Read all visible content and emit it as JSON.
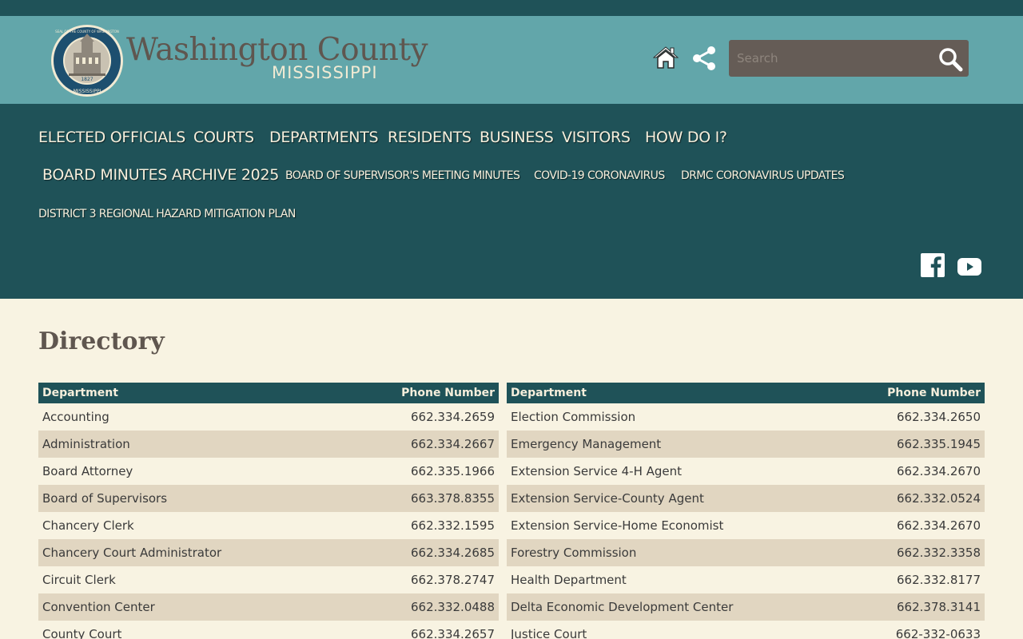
{
  "brand": {
    "title": "Washington County",
    "subtitle": "MISSISSIPPI",
    "seal_ring_text": "SEAL OF THE COUNTY OF WASHINGTON",
    "seal_year": "1827",
    "seal_state": "MISSISSIPPI"
  },
  "search": {
    "placeholder": "Search"
  },
  "nav": {
    "row1": [
      "ELECTED OFFICIALS",
      "COURTS",
      "DEPARTMENTS",
      "RESIDENTS",
      "BUSINESS",
      "VISITORS",
      "HOW DO I?"
    ],
    "row2": [
      "BOARD MINUTES ARCHIVE 2025",
      "BOARD OF SUPERVISOR'S MEETING MINUTES",
      "COVID-19 CORONAVIRUS",
      "DRMC CORONAVIRUS UPDATES"
    ],
    "row3": [
      "DISTRICT 3 REGIONAL HAZARD MITIGATION PLAN"
    ]
  },
  "page": {
    "title": "Directory"
  },
  "directory": {
    "headers": {
      "department": "Department",
      "phone": "Phone Number"
    },
    "left": [
      {
        "dept": "Accounting",
        "phone": "662.334.2659"
      },
      {
        "dept": "Administration",
        "phone": "662.334.2667"
      },
      {
        "dept": "Board Attorney",
        "phone": "662.335.1966"
      },
      {
        "dept": "Board of Supervisors",
        "phone": "663.378.8355"
      },
      {
        "dept": "Chancery Clerk",
        "phone": "662.332.1595"
      },
      {
        "dept": "Chancery Court Administrator",
        "phone": "662.334.2685"
      },
      {
        "dept": "Circuit Clerk",
        "phone": "662.378.2747"
      },
      {
        "dept": "Convention Center",
        "phone": "662.332.0488"
      },
      {
        "dept": "County Court",
        "phone": "662.334.2657"
      }
    ],
    "right": [
      {
        "dept": "Election Commission",
        "phone": "662.334.2650"
      },
      {
        "dept": "Emergency Management",
        "phone": "662.335.1945"
      },
      {
        "dept": "Extension Service 4-H Agent",
        "phone": "662.334.2670"
      },
      {
        "dept": "Extension Service-County Agent",
        "phone": "662.332.0524"
      },
      {
        "dept": "Extension Service-Home Economist",
        "phone": "662.334.2670"
      },
      {
        "dept": "Forestry Commission",
        "phone": "662.332.3358"
      },
      {
        "dept": "Health Department",
        "phone": "662.332.8177"
      },
      {
        "dept": "Delta Economic Development Center",
        "phone": "662.378.3141"
      },
      {
        "dept": "Justice Court",
        "phone": "662-332-0633"
      }
    ]
  },
  "icons": {
    "home": "home-icon",
    "share": "share-icon",
    "search": "search-icon",
    "facebook": "facebook-icon",
    "youtube": "youtube-icon"
  },
  "colors": {
    "header_teal": "#62a6aa",
    "nav_dark_teal": "#1f5258",
    "page_cream": "#f8f3e2",
    "row_alt": "#e1d6c1",
    "search_bg": "#655c56",
    "brand_brown": "#5f564f"
  }
}
